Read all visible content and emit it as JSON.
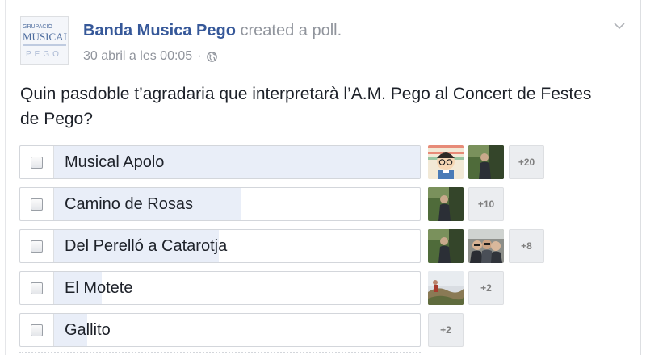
{
  "post": {
    "author": "Banda Musica Pego",
    "action": "created a poll.",
    "timestamp": "30 abril a les 00:05",
    "separator": "·",
    "question": "Quin pasdoble t’agradaria que interpretarà l’A.M. Pego al Concert de Festes de Pego?",
    "page_logo_text": [
      "GRUPACIÓ",
      "MUSICAL",
      "PEGO"
    ]
  },
  "icons": {
    "privacy": "globe-icon",
    "menu": "chevron-down-icon"
  },
  "colors": {
    "link": "#365899",
    "muted": "#90949c",
    "bar_fill": "#e9eef8",
    "border": "#d3d6db"
  },
  "poll": {
    "options": [
      {
        "label": "Musical Apolo",
        "vote_share": 1.0,
        "more": "+20"
      },
      {
        "label": "Camino de Rosas",
        "vote_share": 0.51,
        "more": "+10"
      },
      {
        "label": "Del Perelló a Catarotja",
        "vote_share": 0.45,
        "more": "+8"
      },
      {
        "label": "El Motete",
        "vote_share": 0.13,
        "more": "+2"
      },
      {
        "label": "Gallito",
        "vote_share": 0.09,
        "more": "+2"
      }
    ]
  }
}
